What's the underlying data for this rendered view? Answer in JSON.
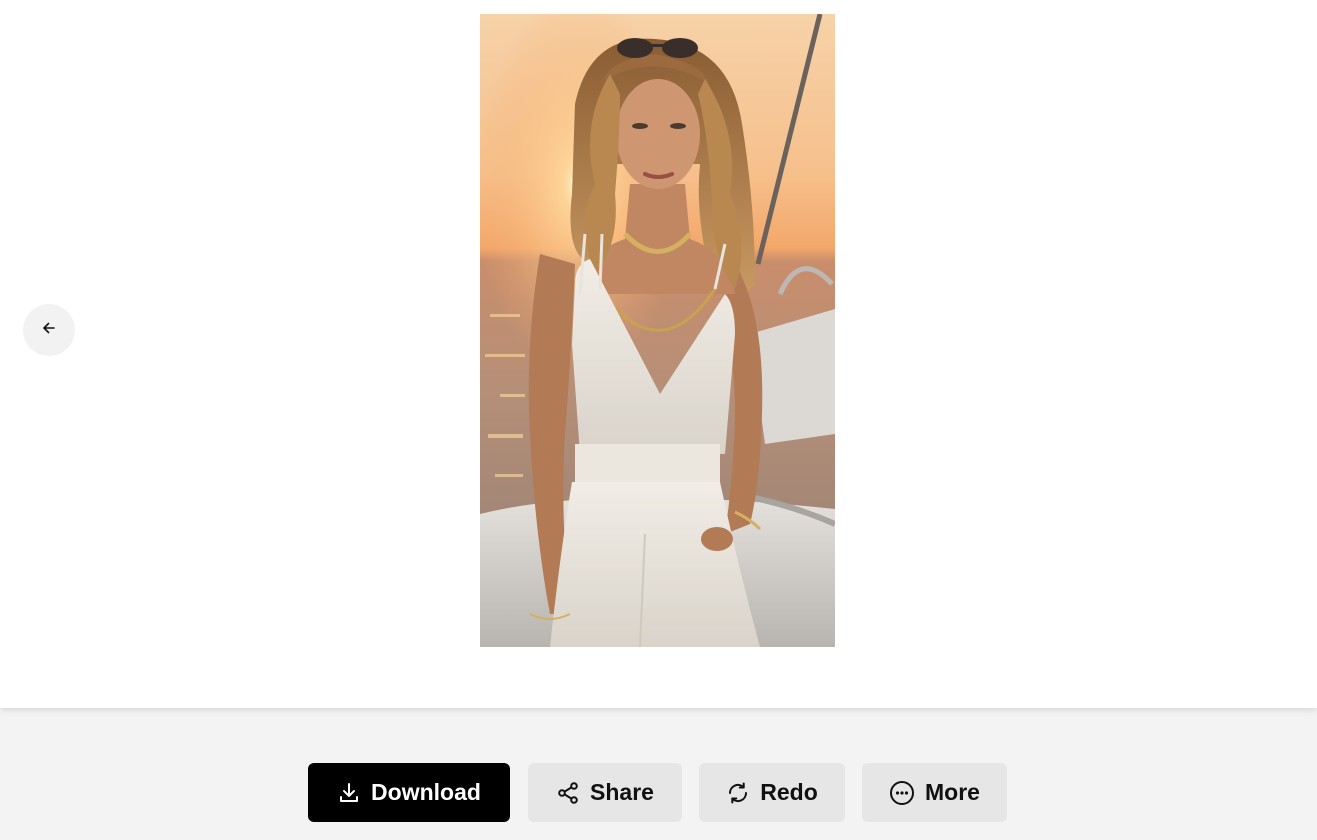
{
  "colors": {
    "page_background": "#f3f3f3",
    "viewer_background": "#ffffff",
    "primary_button": "#000000",
    "secondary_button": "#e6e6e6"
  },
  "viewer": {
    "back_icon": "arrow-left-icon",
    "image": {
      "kind": "generated-photo",
      "subject": "portrait-on-boat-at-sunset"
    }
  },
  "actions": {
    "download": {
      "label": "Download",
      "icon": "download-icon"
    },
    "share": {
      "label": "Share",
      "icon": "share-icon"
    },
    "redo": {
      "label": "Redo",
      "icon": "refresh-icon"
    },
    "more": {
      "label": "More",
      "icon": "more-horizontal-circle-icon"
    }
  }
}
